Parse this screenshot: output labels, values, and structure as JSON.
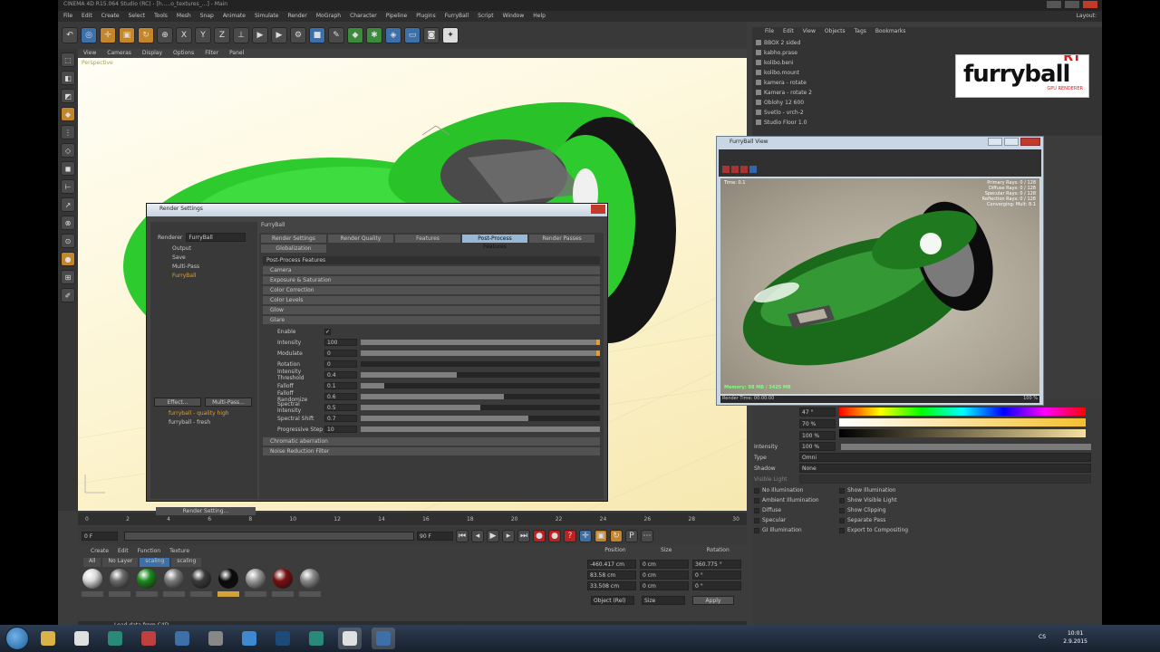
{
  "app": {
    "window_title": "CINEMA 4D R15.064 Studio (RC) - [h.....o_textures_...] - Main",
    "menu": [
      "File",
      "Edit",
      "Create",
      "Select",
      "Tools",
      "Mesh",
      "Snap",
      "Animate",
      "Simulate",
      "Render",
      "MoGraph",
      "Character",
      "Pipeline",
      "Plugins",
      "FurryBall",
      "Script",
      "Window",
      "Help"
    ],
    "layout_label": "Layout:"
  },
  "viewport": {
    "menu": [
      "View",
      "Cameras",
      "Display",
      "Options",
      "Filter",
      "Panel"
    ],
    "label": "Perspective"
  },
  "timeline": {
    "ticks": [
      "0",
      "2",
      "4",
      "6",
      "8",
      "10",
      "12",
      "14",
      "16",
      "18",
      "20",
      "22",
      "24",
      "26",
      "28",
      "30"
    ],
    "frame_field": "0 F",
    "start_field": "0 F",
    "end_field": "90 F"
  },
  "materials": {
    "menu": [
      "Create",
      "Edit",
      "Function",
      "Texture"
    ],
    "tabs": [
      "All",
      "No Layer",
      "scaling",
      "scaling"
    ],
    "selected_tab": 2,
    "items": [
      {
        "color": "#d8d8d8",
        "highlight": false
      },
      {
        "color": "#6a6a6a",
        "highlight": false
      },
      {
        "color": "#1d8a1d",
        "highlight": false
      },
      {
        "color": "#7a7a7a",
        "highlight": false
      },
      {
        "color": "#3a3a3a",
        "highlight": false
      },
      {
        "color": "#0a0a0a",
        "highlight": true
      },
      {
        "color": "#9a9a9a",
        "highlight": false
      },
      {
        "color": "#7a1010",
        "highlight": false
      },
      {
        "color": "#8a8a8a",
        "highlight": false
      }
    ]
  },
  "coordinates": {
    "headers": [
      "Position",
      "Size",
      "Rotation"
    ],
    "rows": [
      [
        "-460.417 cm",
        "0 cm",
        "360.775 °"
      ],
      [
        "83.58 cm",
        "0 cm",
        "0 °"
      ],
      [
        "33.508 cm",
        "0 cm",
        "0 °"
      ]
    ],
    "mode": "Object (Rel)",
    "size_mode": "Size",
    "apply": "Apply"
  },
  "status": "Load data from C4D",
  "object_manager": {
    "menu": [
      "File",
      "Edit",
      "View",
      "Objects",
      "Tags",
      "Bookmarks"
    ],
    "rows": [
      "BBOX 2 sided",
      "kabho.prase",
      "kolibo.beni",
      "kolibo.mount",
      "kamera - rotate",
      "Kamera - rotate 2",
      "Oblohy 12 600",
      "Svetlo - vrch-2",
      "Studio Floor 1.0"
    ]
  },
  "render_settings": {
    "title": "Render Settings",
    "renderer_label": "Renderer",
    "renderer_value": "FurryBall",
    "tree": [
      "Output",
      "Save",
      "Multi-Pass",
      "FurryBall"
    ],
    "effect_btn": "Effect...",
    "multipass_btn": "Multi-Pass...",
    "presets": [
      "furryball - quality high",
      "furryball - fresh"
    ],
    "bottom_button": "Render Setting...",
    "panel_title": "FurryBall",
    "tabs": [
      "Render Settings",
      "Render Quality",
      "Features",
      "Post-Process Features",
      "Render Passes",
      "Globalization"
    ],
    "selected_tab": 3,
    "group_title": "Post-Process Features",
    "sections": [
      "Camera",
      "Exposure & Saturation",
      "Color Correction",
      "Color Levels",
      "Glow",
      "Glare"
    ],
    "enable_label": "Enable",
    "params": [
      {
        "label": "Intensity",
        "value": "100",
        "fill": 1.0
      },
      {
        "label": "Modulate",
        "value": "0",
        "fill": 1.0
      },
      {
        "label": "Rotation",
        "value": "0",
        "fill": 0.0
      },
      {
        "label": "Intensity Threshold",
        "value": "0.4",
        "fill": 0.4
      },
      {
        "label": "Falloff",
        "value": "0.1",
        "fill": 0.1
      },
      {
        "label": "Falloff Randomize",
        "value": "0.6",
        "fill": 0.6
      },
      {
        "label": "Spectral Intensity",
        "value": "0.5",
        "fill": 0.5
      },
      {
        "label": "Spectral Shift",
        "value": "0.7",
        "fill": 0.7
      },
      {
        "label": "Progressive Step",
        "value": "10",
        "fill": 1.0
      }
    ],
    "bottom_sections": [
      "Chromatic aberration",
      "Noise Reduction Filter"
    ]
  },
  "furryball_view": {
    "title": "FurryBall View",
    "time": "Time: 0.1",
    "stats": [
      "Primary Rays: 0 / 128",
      "Diffuse Rays: 0 / 128",
      "Specular Rays: 0 / 128",
      "Reflection Rays: 0 / 128",
      "Converging: Mult: 8.1"
    ],
    "memory": "Memory: 98 MB / 3425 MB",
    "footer": "Render Time: 00:00:00",
    "zoom": "100 %"
  },
  "attributes": {
    "hue_value": "47 °",
    "sat_value": "70 %",
    "val_value": "100 %",
    "intensity_label": "Intensity",
    "intensity_value": "100 %",
    "type_label": "Type",
    "type_value": "Omni",
    "shadow_label": "Shadow",
    "shadow_value": "None",
    "visible_light_label": "Visible Light",
    "left_opts": [
      "No Illumination",
      "Ambient Illumination",
      "Diffuse",
      "Specular",
      "GI Illumination"
    ],
    "right_opts": [
      "Show Illumination",
      "Show Visible Light",
      "Show Clipping",
      "Separate Pass",
      "Export to Compositing"
    ]
  },
  "logo": {
    "text": "furryball",
    "rt": "RT",
    "sub": "GPU RENDERER"
  },
  "taskbar": {
    "lang": "CS",
    "time": "10:01",
    "date": "2.9.2015",
    "apps": [
      {
        "name": "explorer",
        "color": "#d9b24a"
      },
      {
        "name": "chrome",
        "color": "#e0e0e0"
      },
      {
        "name": "sourcetree",
        "color": "#2a8a7a"
      },
      {
        "name": "game",
        "color": "#c04040"
      },
      {
        "name": "save",
        "color": "#3d6fa8"
      },
      {
        "name": "tools",
        "color": "#888888"
      },
      {
        "name": "ie",
        "color": "#3d8ad0"
      },
      {
        "name": "photoshop",
        "color": "#1e4a7a"
      },
      {
        "name": "premiere",
        "color": "#2a8a7a"
      },
      {
        "name": "chrome2",
        "color": "#e0e0e0"
      },
      {
        "name": "cinema4d",
        "color": "#3d6fa8"
      }
    ]
  }
}
